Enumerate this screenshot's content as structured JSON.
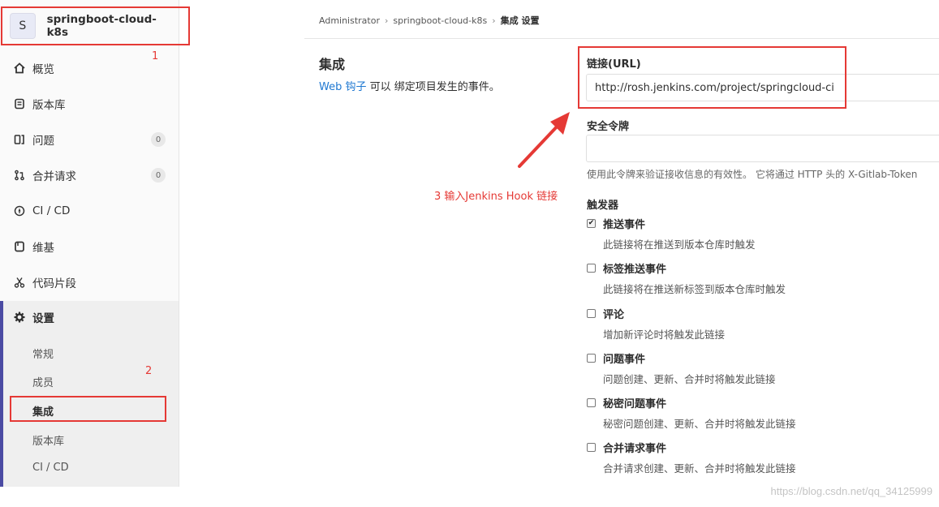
{
  "sidebar": {
    "avatar_letter": "S",
    "project_name": "springboot-cloud-k8s",
    "items": [
      {
        "icon": "home-icon",
        "label": "概览"
      },
      {
        "icon": "repository-icon",
        "label": "版本库"
      },
      {
        "icon": "issues-icon",
        "label": "问题",
        "badge": "0"
      },
      {
        "icon": "merge-request-icon",
        "label": "合并请求",
        "badge": "0"
      },
      {
        "icon": "rocket-icon",
        "label": "CI / CD"
      },
      {
        "icon": "wiki-icon",
        "label": "维基"
      },
      {
        "icon": "snippet-icon",
        "label": "代码片段"
      }
    ],
    "settings": {
      "label": "设置",
      "sub_items": [
        "常规",
        "成员",
        "集成",
        "版本库",
        "CI / CD"
      ]
    }
  },
  "breadcrumb": {
    "root": "Administrator",
    "project": "springboot-cloud-k8s",
    "current": "集成 设置"
  },
  "main": {
    "title": "集成",
    "desc_link": "Web 钩子",
    "desc_rest": " 可以 绑定项目发生的事件。",
    "url_label": "链接(URL)",
    "url_value": "http://rosh.jenkins.com/project/springcloud-ci",
    "token_label": "安全令牌",
    "token_value": "",
    "token_help": "使用此令牌来验证接收信息的有效性。 它将通过 HTTP 头的 X-Gitlab-Token",
    "triggers_label": "触发器",
    "triggers": [
      {
        "name": "推送事件",
        "desc": "此链接将在推送到版本仓库时触发",
        "checked": true
      },
      {
        "name": "标签推送事件",
        "desc": "此链接将在推送新标签到版本仓库时触发",
        "checked": false
      },
      {
        "name": "评论",
        "desc": "增加新评论时将触发此链接",
        "checked": false
      },
      {
        "name": "问题事件",
        "desc": "问题创建、更新、合并时将触发此链接",
        "checked": false
      },
      {
        "name": "秘密问题事件",
        "desc": "秘密问题创建、更新、合并时将触发此链接",
        "checked": false
      },
      {
        "name": "合并请求事件",
        "desc": "合并请求创建、更新、合并时将触发此链接",
        "checked": false
      }
    ]
  },
  "annotations": {
    "step1": "1",
    "step2": "2",
    "step3": "3 输入Jenkins Hook 链接",
    "color": "#e53935"
  },
  "footer": {
    "watermark": "https://blog.csdn.net/qq_34125999"
  }
}
